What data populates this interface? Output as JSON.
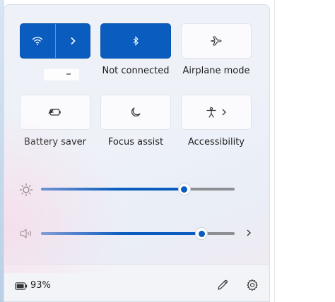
{
  "quick_settings": {
    "tiles": [
      {
        "id": "wifi",
        "label": "",
        "state": "on"
      },
      {
        "id": "bluetooth",
        "label": "Not connected",
        "state": "on"
      },
      {
        "id": "airplane",
        "label": "Airplane mode",
        "state": "off"
      },
      {
        "id": "battery-saver",
        "label": "Battery saver",
        "state": "off"
      },
      {
        "id": "focus-assist",
        "label": "Focus assist",
        "state": "off"
      },
      {
        "id": "accessibility",
        "label": "Accessibility",
        "state": "off"
      }
    ],
    "brightness": {
      "level_percent": 74
    },
    "volume": {
      "level_percent": 83
    }
  },
  "footer": {
    "battery_text": "93%"
  },
  "icons": {
    "wifi": "wifi-icon",
    "expand": "chevron-right-icon",
    "bluetooth": "bluetooth-icon",
    "airplane": "airplane-icon",
    "battery_saver": "battery-saver-icon",
    "focus": "moon-icon",
    "accessibility": "accessibility-icon",
    "brightness": "sun-icon",
    "volume": "speaker-icon",
    "battery": "battery-icon",
    "edit": "pencil-icon",
    "settings": "gear-icon"
  },
  "colors": {
    "accent": "#0a5dbf",
    "track": "#8e8f92"
  }
}
